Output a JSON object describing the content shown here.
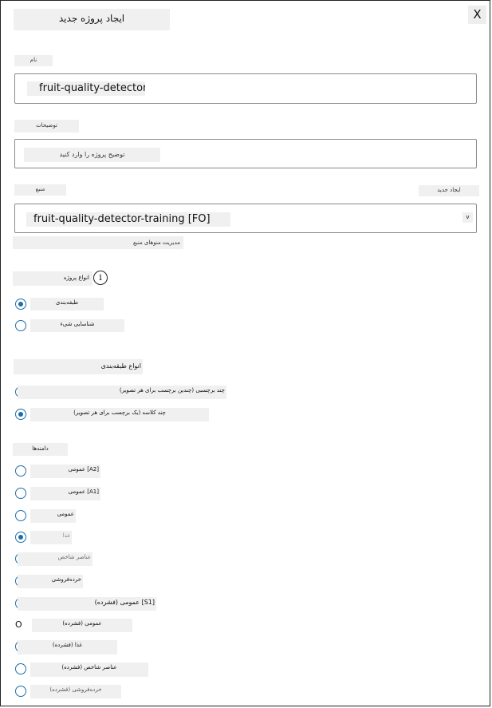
{
  "dialog": {
    "title": "ایجاد پروژه جدید",
    "close_label": "X"
  },
  "name": {
    "label": "نام",
    "value": "fruit-quality-detector"
  },
  "description": {
    "label": "توضیحات",
    "placeholder": "توضیح پروژه را وارد کنید"
  },
  "resource": {
    "label": "منبع",
    "create_new_label": "ایجاد جدید",
    "selected": "fruit-quality-detector-training [FO]",
    "chevron": "v",
    "manage_link": "مدیریت منوهای منبع"
  },
  "project_types": {
    "label": "انواع پروژه",
    "info_icon": "i",
    "options": [
      {
        "label": "طبقه‌بندی",
        "checked": true
      },
      {
        "label": "شناسایی شیء",
        "checked": false
      }
    ]
  },
  "classification_types": {
    "label": "انواع طبقه‌بندی",
    "options": [
      {
        "label": "چند برچسبی (چندین برچسب برای هر تصویر)",
        "checked": false
      },
      {
        "label": "چند کلاسه (یک برچسب برای هر تصویر)",
        "checked": true
      }
    ]
  },
  "domains": {
    "label": "دامنه‌ها",
    "options": [
      {
        "label": "عمومی [A2]",
        "checked": false
      },
      {
        "label": "عمومی [A1]",
        "checked": false
      },
      {
        "label": "عمومی",
        "checked": false
      },
      {
        "label": "غذا",
        "checked": true
      },
      {
        "label": "عناصر شاخص",
        "checked": false
      },
      {
        "label": "خرده‌فروشی",
        "checked": false
      },
      {
        "label": "عمومی (فشرده) [S1]",
        "checked": false
      },
      {
        "label": "عمومی (فشرده)",
        "checked": false
      },
      {
        "label": "غذا (فشرده)",
        "checked": false
      },
      {
        "label": "عناصر شاخص (فشرده)",
        "checked": false
      },
      {
        "label": "خرده‌فروشی (فشرده)",
        "checked": false
      }
    ]
  }
}
